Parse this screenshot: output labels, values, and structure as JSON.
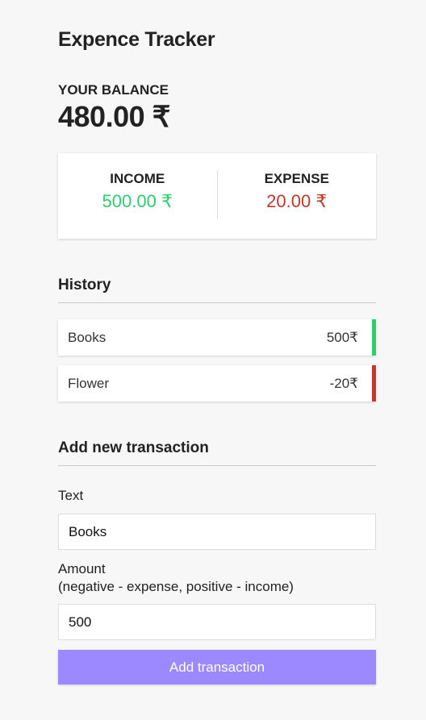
{
  "header": {
    "title": "Expence Tracker"
  },
  "balance": {
    "label": "YOUR BALANCE",
    "amount": "480.00 ₹"
  },
  "summary": {
    "income_label": "INCOME",
    "income_value": "500.00 ₹",
    "expense_label": "EXPENSE",
    "expense_value": "20.00 ₹"
  },
  "history": {
    "title": "History",
    "items": [
      {
        "text": "Books",
        "amount": "500₹",
        "type": "plus"
      },
      {
        "text": "Flower",
        "amount": "-20₹",
        "type": "minus"
      }
    ]
  },
  "form": {
    "title": "Add new transaction",
    "text_label": "Text",
    "text_value": "Books",
    "amount_label_line1": "Amount",
    "amount_label_line2": "(negative - expense, positive - income)",
    "amount_value": "500",
    "submit_label": "Add transaction"
  },
  "colors": {
    "income": "#2ecc71",
    "expense": "#c0392b",
    "button": "#9c88ff",
    "background": "#f7f7f7"
  }
}
